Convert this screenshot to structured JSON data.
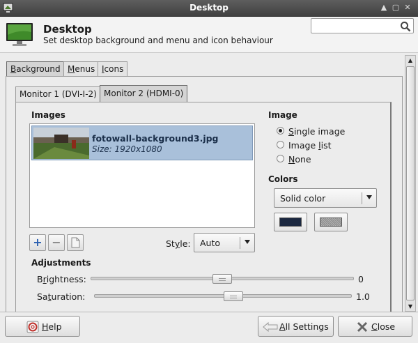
{
  "window": {
    "title": "Desktop"
  },
  "header": {
    "title": "Desktop",
    "subtitle": "Set desktop background and menu and icon behaviour",
    "search_value": ""
  },
  "tabs": [
    {
      "label": "Background",
      "mnemonic": "B",
      "rest": "ackground"
    },
    {
      "label": "Menus",
      "mnemonic": "M",
      "rest": "enus"
    },
    {
      "label": "Icons",
      "mnemonic": "I",
      "rest": "cons"
    }
  ],
  "monitor_tabs": [
    "Monitor 1 (DVI-I-2)",
    "Monitor 2 (HDMI-0)"
  ],
  "images": {
    "section": "Images",
    "items": [
      {
        "name": "fotowall-background3.jpg",
        "size": "Size: 1920x1080"
      }
    ],
    "style_label_pre": "St",
    "style_label_mn": "y",
    "style_label_post": "le:",
    "style_value": "Auto"
  },
  "image_mode": {
    "section": "Image",
    "options": [
      {
        "pre": "",
        "mn": "S",
        "post": "ingle image",
        "selected": true
      },
      {
        "pre": "Image ",
        "mn": "l",
        "post": "ist",
        "selected": false
      },
      {
        "pre": "",
        "mn": "N",
        "post": "one",
        "selected": false
      }
    ]
  },
  "colors": {
    "section": "Colors",
    "mode": "Solid color",
    "color1": "#1b2840",
    "color2": "#9a9a9a"
  },
  "adjustments": {
    "section": "Adjustments",
    "brightness": {
      "pre": "B",
      "mn": "r",
      "post": "ightness:",
      "value": "0",
      "fraction": 0.5
    },
    "saturation": {
      "pre": "Sa",
      "mn": "t",
      "post": "uration:",
      "value": "1.0",
      "fraction": 0.54
    }
  },
  "buttons": {
    "help": {
      "mn": "H",
      "post": "elp"
    },
    "all_settings": {
      "mn": "A",
      "post": "ll Settings"
    },
    "close": {
      "mn": "C",
      "post": "lose"
    }
  }
}
